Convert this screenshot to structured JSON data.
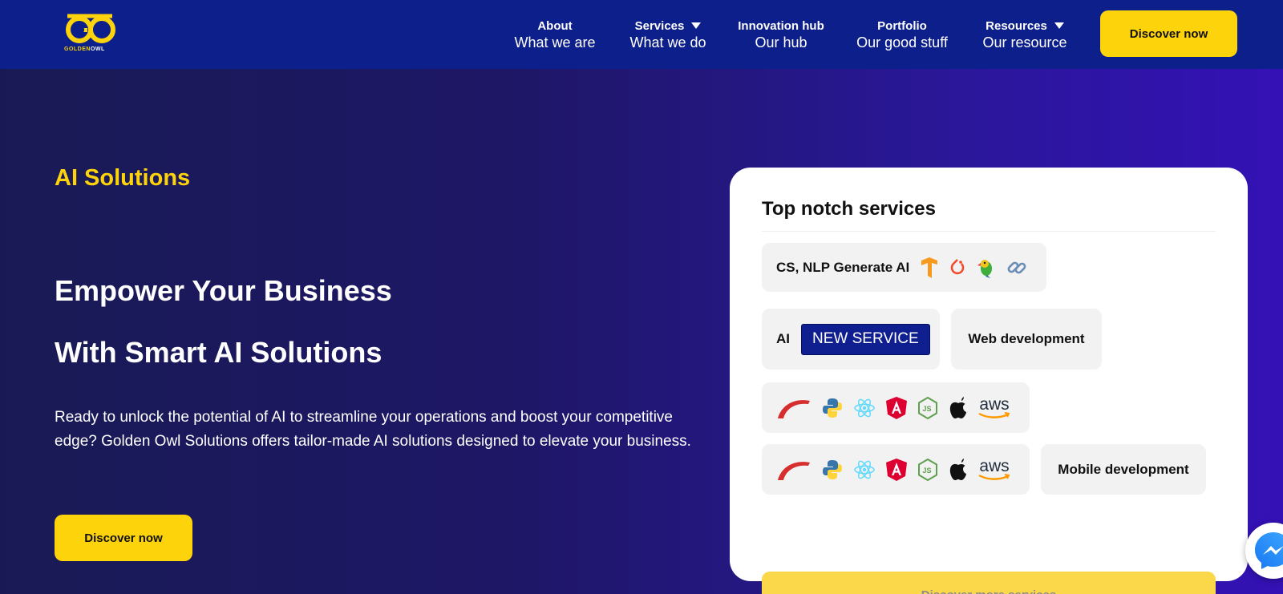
{
  "brand": {
    "logo_mark": "GO",
    "logo_text_a": "GOLDEN",
    "logo_text_b": "OWL",
    "accent": "#fdd30c",
    "header_bg": "#0c1f8a"
  },
  "nav": {
    "items": [
      {
        "top": "About",
        "sub": "What we are",
        "has_caret": false
      },
      {
        "top": "Services",
        "sub": "What we do",
        "has_caret": true
      },
      {
        "top": "Innovation hub",
        "sub": "Our hub",
        "has_caret": false
      },
      {
        "top": "Portfolio",
        "sub": "Our good stuff",
        "has_caret": false
      },
      {
        "top": "Resources",
        "sub": "Our resource",
        "has_caret": true
      }
    ],
    "cta_label": "Discover now"
  },
  "hero": {
    "eyebrow": "AI Solutions",
    "headline_1": "Empower Your Business",
    "headline_2": "With Smart AI Solutions",
    "description": "Ready to unlock the potential of AI to streamline your operations and boost your competitive edge? Golden Owl Solutions offers tailor-made AI solutions designed to elevate your business.",
    "cta_label": "Discover now"
  },
  "services_card": {
    "title": "Top notch services",
    "pill_ai_nlp": "CS, NLP Generate AI",
    "pill_ai_nlp_icons": [
      "tensorflow-icon",
      "pytorch-icon",
      "parrot-icon",
      "link-icon"
    ],
    "pill_ai": "AI",
    "new_badge": "NEW SERVICE",
    "pill_web": "Web development",
    "pill_mobile": "Mobile development",
    "tech_icons": [
      "rails-icon",
      "python-icon",
      "react-icon",
      "angular-icon",
      "nodejs-icon",
      "apple-icon",
      "aws-icon"
    ],
    "aws_text": "aws",
    "more_label": "Discover more services"
  },
  "messenger": {
    "icon": "messenger-icon"
  }
}
